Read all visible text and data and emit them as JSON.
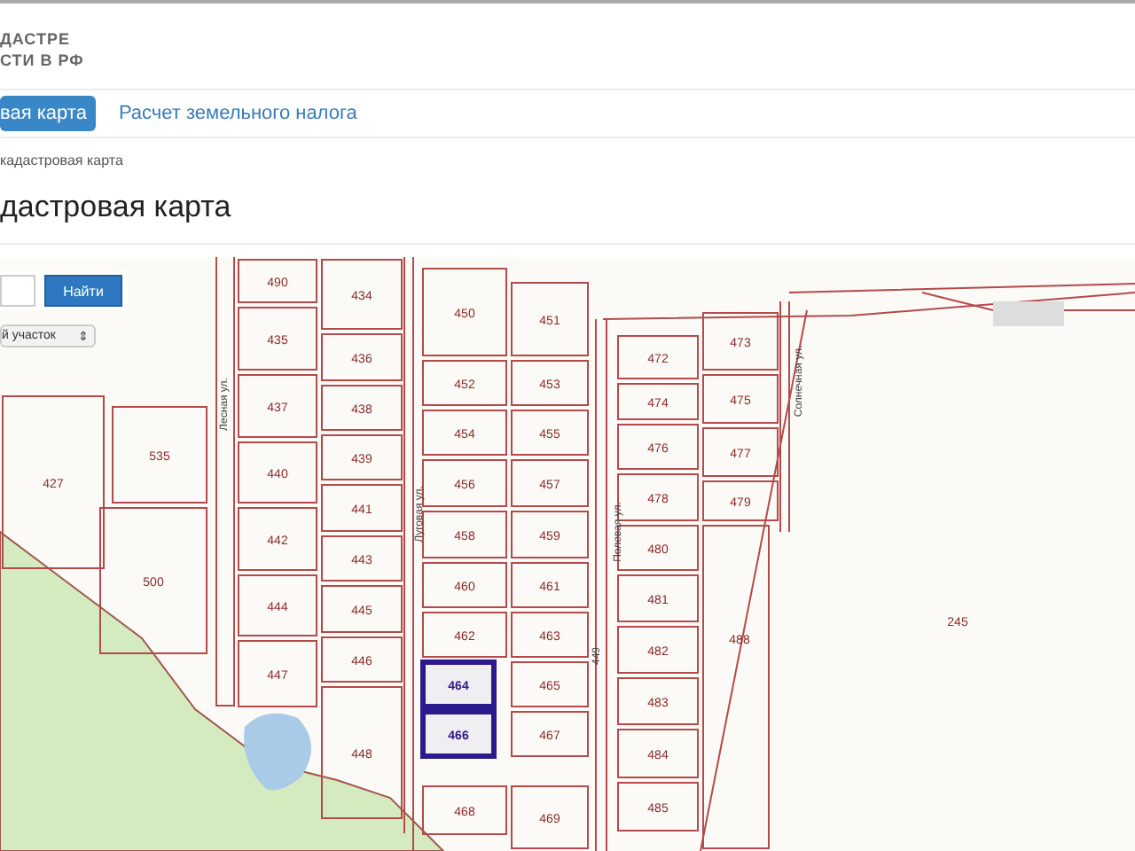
{
  "site_title": [
    "ДАСТРЕ",
    "СТИ В РФ"
  ],
  "tabs": [
    {
      "label": "вая карта",
      "selected": true
    },
    {
      "label": "Расчет земельного налога",
      "selected": false
    }
  ],
  "breadcrumb": "кадастровая карта",
  "heading": "дастровая карта",
  "map": {
    "search": {
      "button": "Найти"
    },
    "select": {
      "value": "й участок",
      "arrow": "⇕"
    },
    "parcels": [
      {
        "number": "490",
        "selected": false
      },
      {
        "number": "435",
        "selected": false
      },
      {
        "number": "437",
        "selected": false
      },
      {
        "number": "440",
        "selected": false
      },
      {
        "number": "442",
        "selected": false
      },
      {
        "number": "444",
        "selected": false
      },
      {
        "number": "447",
        "selected": false
      },
      {
        "number": "434",
        "selected": false
      },
      {
        "number": "436",
        "selected": false
      },
      {
        "number": "438",
        "selected": false
      },
      {
        "number": "439",
        "selected": false
      },
      {
        "number": "441",
        "selected": false
      },
      {
        "number": "443",
        "selected": false
      },
      {
        "number": "445",
        "selected": false
      },
      {
        "number": "446",
        "selected": false
      },
      {
        "number": "448",
        "selected": false
      },
      {
        "number": "450",
        "selected": false
      },
      {
        "number": "452",
        "selected": false
      },
      {
        "number": "454",
        "selected": false
      },
      {
        "number": "456",
        "selected": false
      },
      {
        "number": "458",
        "selected": false
      },
      {
        "number": "460",
        "selected": false
      },
      {
        "number": "462",
        "selected": false
      },
      {
        "number": "464",
        "selected": true
      },
      {
        "number": "466",
        "selected": true
      },
      {
        "number": "468",
        "selected": false
      },
      {
        "number": "451",
        "selected": false
      },
      {
        "number": "453",
        "selected": false
      },
      {
        "number": "455",
        "selected": false
      },
      {
        "number": "457",
        "selected": false
      },
      {
        "number": "459",
        "selected": false
      },
      {
        "number": "461",
        "selected": false
      },
      {
        "number": "463",
        "selected": false
      },
      {
        "number": "465",
        "selected": false
      },
      {
        "number": "467",
        "selected": false
      },
      {
        "number": "469",
        "selected": false
      },
      {
        "number": "472",
        "selected": false
      },
      {
        "number": "474",
        "selected": false
      },
      {
        "number": "476",
        "selected": false
      },
      {
        "number": "478",
        "selected": false
      },
      {
        "number": "480",
        "selected": false
      },
      {
        "number": "481",
        "selected": false
      },
      {
        "number": "482",
        "selected": false
      },
      {
        "number": "483",
        "selected": false
      },
      {
        "number": "484",
        "selected": false
      },
      {
        "number": "485",
        "selected": false
      },
      {
        "number": "473",
        "selected": false
      },
      {
        "number": "475",
        "selected": false
      },
      {
        "number": "477",
        "selected": false
      },
      {
        "number": "479",
        "selected": false
      },
      {
        "number": "488",
        "selected": false
      },
      {
        "number": "427",
        "selected": false
      },
      {
        "number": "535",
        "selected": false
      },
      {
        "number": "500",
        "selected": false
      },
      {
        "number": "245",
        "selected": false
      }
    ],
    "streets": [
      "Лесная ул.",
      "Луговая ул.",
      "Полевая ул.",
      "449",
      "Солнечная ул."
    ]
  }
}
